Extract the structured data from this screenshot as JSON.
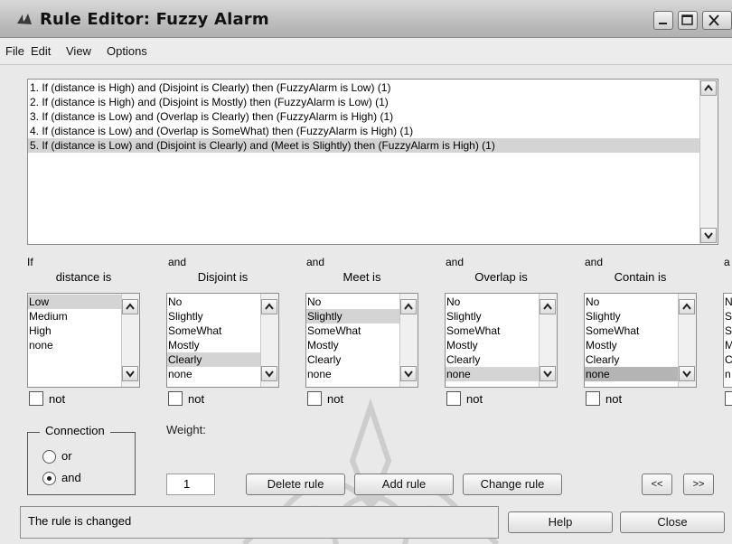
{
  "window": {
    "title": "Rule Editor: Fuzzy Alarm"
  },
  "menu": [
    "File",
    "Edit",
    "View",
    "Options"
  ],
  "rules": [
    "1. If (distance is High) and (Disjoint is Clearly) then (FuzzyAlarm is Low) (1)",
    "2. If (distance is High) and (Disjoint is Mostly) then (FuzzyAlarm is Low) (1)",
    "3. If (distance is Low) and (Overlap is Clearly) then (FuzzyAlarm is High) (1)",
    "4. If (distance is Low) and (Overlap is SomeWhat) then (FuzzyAlarm is High) (1)",
    "5. If (distance is Low) and (Disjoint is Clearly) and (Meet is Slightly) then (FuzzyAlarm is High) (1)"
  ],
  "selected_rule": 4,
  "inputs": {
    "if_label": "If",
    "and_label": "and",
    "columns": [
      {
        "title": "distance is",
        "options": [
          "Low",
          "Medium",
          "High",
          "none"
        ],
        "selected": 0
      },
      {
        "title": "Disjoint is",
        "options": [
          "No",
          "Slightly",
          "SomeWhat",
          "Mostly",
          "Clearly",
          "none"
        ],
        "selected": 4
      },
      {
        "title": "Meet is",
        "options": [
          "No",
          "Slightly",
          "SomeWhat",
          "Mostly",
          "Clearly",
          "none"
        ],
        "selected": 1
      },
      {
        "title": "Overlap is",
        "options": [
          "No",
          "Slightly",
          "SomeWhat",
          "Mostly",
          "Clearly",
          "none"
        ],
        "selected": 5
      },
      {
        "title": "Contain is",
        "options": [
          "No",
          "Slightly",
          "SomeWhat",
          "Mostly",
          "Clearly",
          "none"
        ],
        "selected": 5
      },
      {
        "partial_and": "a",
        "partial_options": [
          "N",
          "S",
          "S",
          "M",
          "C",
          "n"
        ]
      }
    ],
    "not_label": "not"
  },
  "connection": {
    "title": "Connection",
    "or_label": "or",
    "and_label": "and",
    "selected": "and"
  },
  "weight": {
    "label": "Weight:",
    "value": "1"
  },
  "buttons": {
    "delete_rule": "Delete rule",
    "add_rule": "Add rule",
    "change_rule": "Change rule",
    "prev": "<<",
    "next": ">>",
    "help": "Help",
    "close": "Close"
  },
  "status": "The rule is changed"
}
